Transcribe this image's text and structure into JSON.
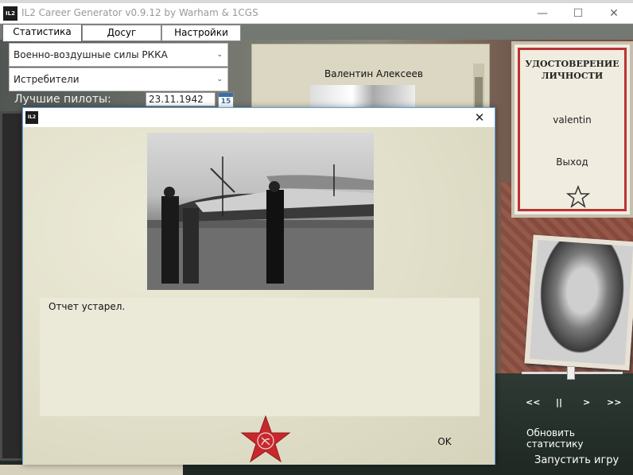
{
  "window": {
    "logo_text": "IL2",
    "title": "IL2 Career Generator v0.9.12 by Warham & 1CGS",
    "behind_text": "...",
    "controls": {
      "minimize": "—",
      "maximize": "☐",
      "close": "✕"
    }
  },
  "tabs": [
    {
      "label": "Статистика",
      "active": true
    },
    {
      "label": "Досуг",
      "active": false
    },
    {
      "label": "Настройки",
      "active": false
    }
  ],
  "filters": {
    "air_force": "Военно-воздушные силы РККА",
    "branch": "Истребители"
  },
  "best_pilots": {
    "label": "Лучшие пилоты:",
    "date": "23.11.1942",
    "calendar_day": "15"
  },
  "pilot_list": {
    "name": "Валентин Алексеев"
  },
  "id_card": {
    "title": "УДОСТОВЕРЕНИЕ ЛИЧНОСТИ",
    "username": "valentin",
    "exit_label": "Выход"
  },
  "media_controls": {
    "prev": "<<",
    "pause": "||",
    "next": ">",
    "fast_forward": ">>",
    "volume": 0.5
  },
  "side_buttons": {
    "refresh_stats": "Обновить статистику",
    "launch_game": "Запустить игру"
  },
  "dialog": {
    "logo_text": "IL2",
    "close": "✕",
    "report_text": "Отчет устарел.",
    "ok_label": "OK"
  },
  "colors": {
    "accent_red": "#c8282c",
    "dialog_border": "#5ea2dc",
    "paper": "#e1dfc9"
  }
}
